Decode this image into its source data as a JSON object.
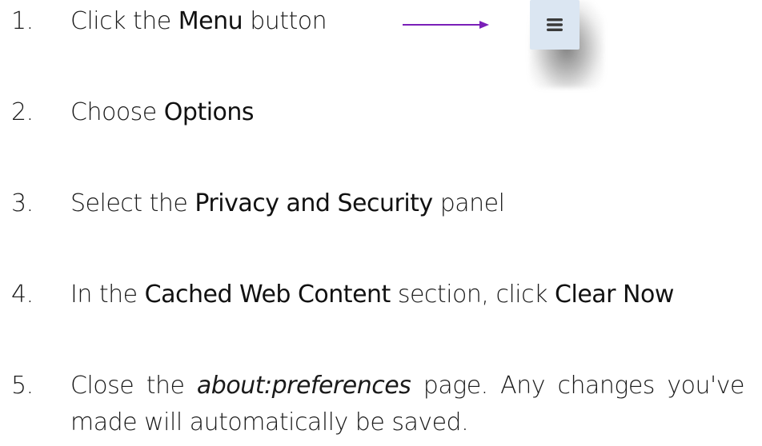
{
  "steps": [
    {
      "number": "1.",
      "segments": [
        "Click the ",
        "Menu",
        " button"
      ]
    },
    {
      "number": "2.",
      "segments": [
        "Choose ",
        "Options"
      ]
    },
    {
      "number": "3.",
      "segments": [
        "Select the ",
        "Privacy and Security",
        " panel"
      ]
    },
    {
      "number": "4.",
      "segments": [
        "In the ",
        "Cached Web Content",
        " section, click ",
        "Clear Now"
      ]
    },
    {
      "number": "5.",
      "segments": [
        "Close the ",
        "about:preferences",
        " page. Any changes you've made will automatically be saved."
      ]
    }
  ],
  "colors": {
    "arrow": "#7a1fb8",
    "menu_button_bg": "#dbe6f2",
    "menu_icon": "#3a3a3a"
  },
  "icons": {
    "menu": "hamburger-menu-icon",
    "arrow": "right-arrow-icon"
  }
}
